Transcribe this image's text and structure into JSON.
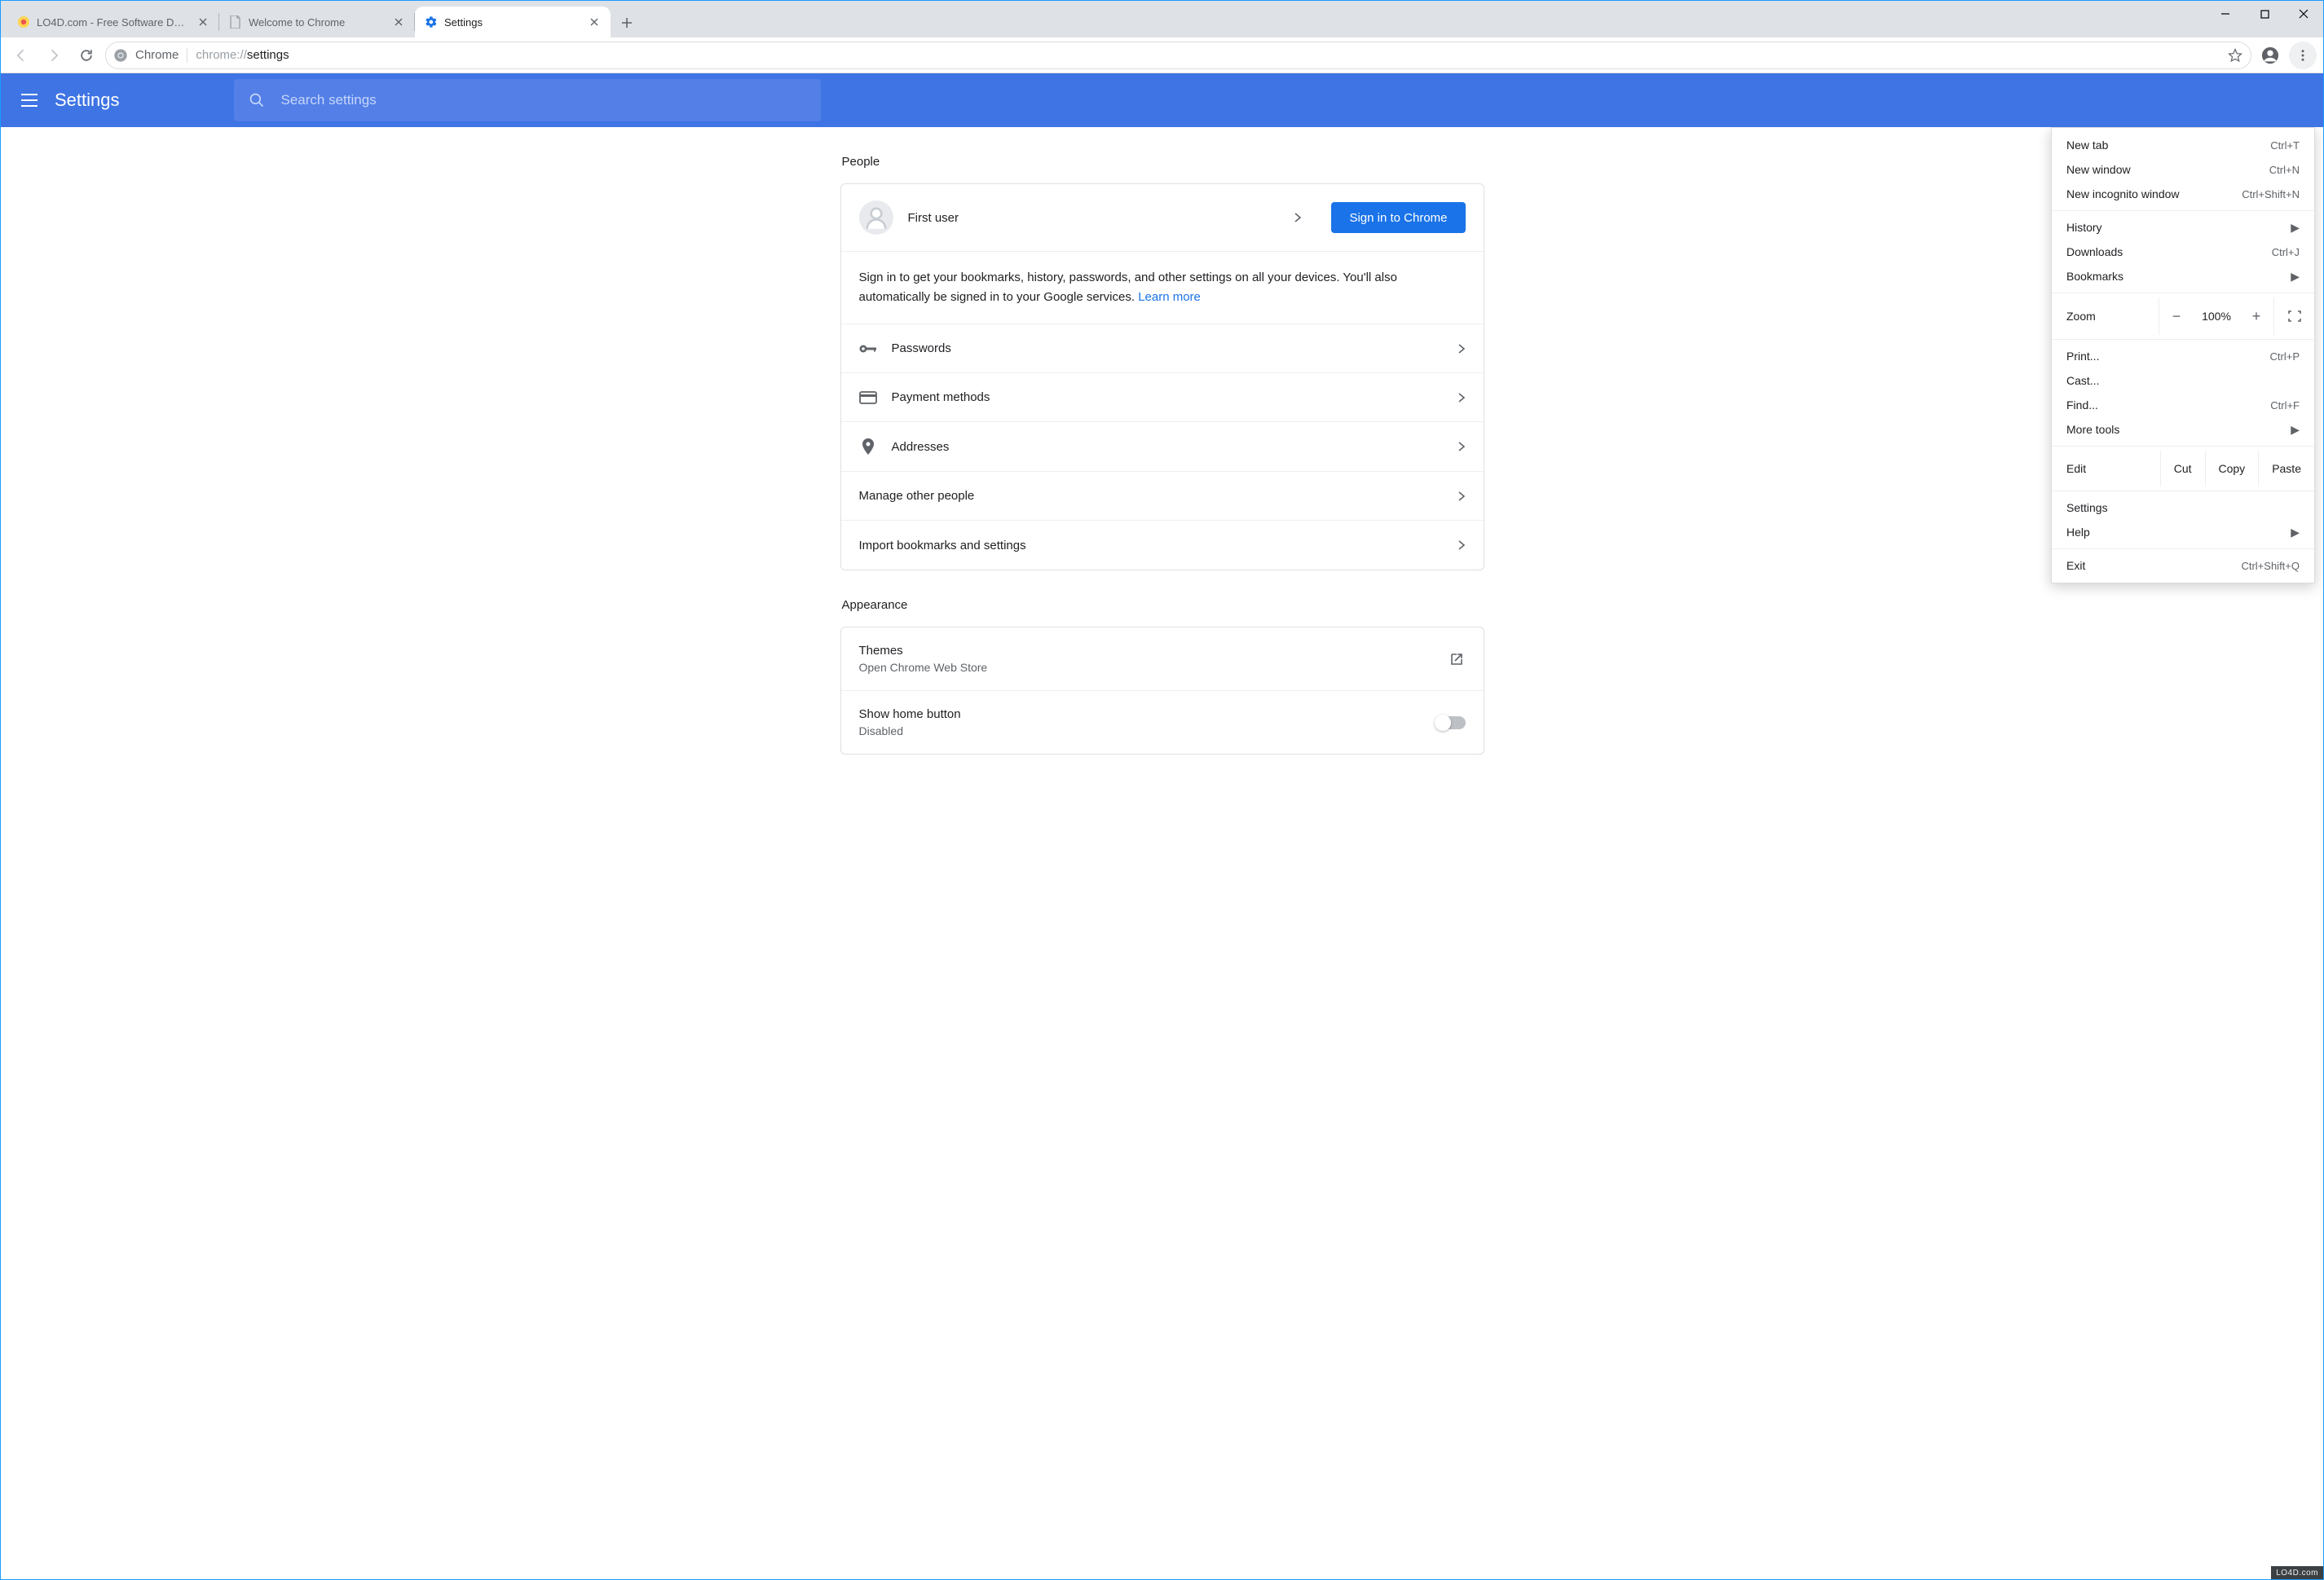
{
  "window": {
    "tabs": [
      {
        "label": "LO4D.com - Free Software Downl",
        "active": false
      },
      {
        "label": "Welcome to Chrome",
        "active": false
      },
      {
        "label": "Settings",
        "active": true
      }
    ]
  },
  "addressbar": {
    "scheme_label": "Chrome",
    "url_prefix": "chrome://",
    "url_bold": "settings"
  },
  "settings_header": {
    "title": "Settings",
    "search_placeholder": "Search settings"
  },
  "sections": {
    "people": {
      "title": "People",
      "user_name": "First user",
      "sign_in_button": "Sign in to Chrome",
      "sign_in_desc": "Sign in to get your bookmarks, history, passwords, and other settings on all your devices. You'll also automatically be signed in to your Google services. ",
      "learn_more": "Learn more",
      "passwords": "Passwords",
      "payment": "Payment methods",
      "addresses": "Addresses",
      "manage_other": "Manage other people",
      "import": "Import bookmarks and settings"
    },
    "appearance": {
      "title": "Appearance",
      "themes": "Themes",
      "themes_sub": "Open Chrome Web Store",
      "home_button": "Show home button",
      "home_button_sub": "Disabled"
    }
  },
  "menu": {
    "new_tab": "New tab",
    "new_tab_s": "Ctrl+T",
    "new_window": "New window",
    "new_window_s": "Ctrl+N",
    "new_incognito": "New incognito window",
    "new_incognito_s": "Ctrl+Shift+N",
    "history": "History",
    "downloads": "Downloads",
    "downloads_s": "Ctrl+J",
    "bookmarks": "Bookmarks",
    "zoom_label": "Zoom",
    "zoom_value": "100%",
    "print": "Print...",
    "print_s": "Ctrl+P",
    "cast": "Cast...",
    "find": "Find...",
    "find_s": "Ctrl+F",
    "more_tools": "More tools",
    "edit": "Edit",
    "cut": "Cut",
    "copy": "Copy",
    "paste": "Paste",
    "settings": "Settings",
    "help": "Help",
    "exit": "Exit",
    "exit_s": "Ctrl+Shift+Q"
  },
  "footer_wm": "LO4D.com"
}
